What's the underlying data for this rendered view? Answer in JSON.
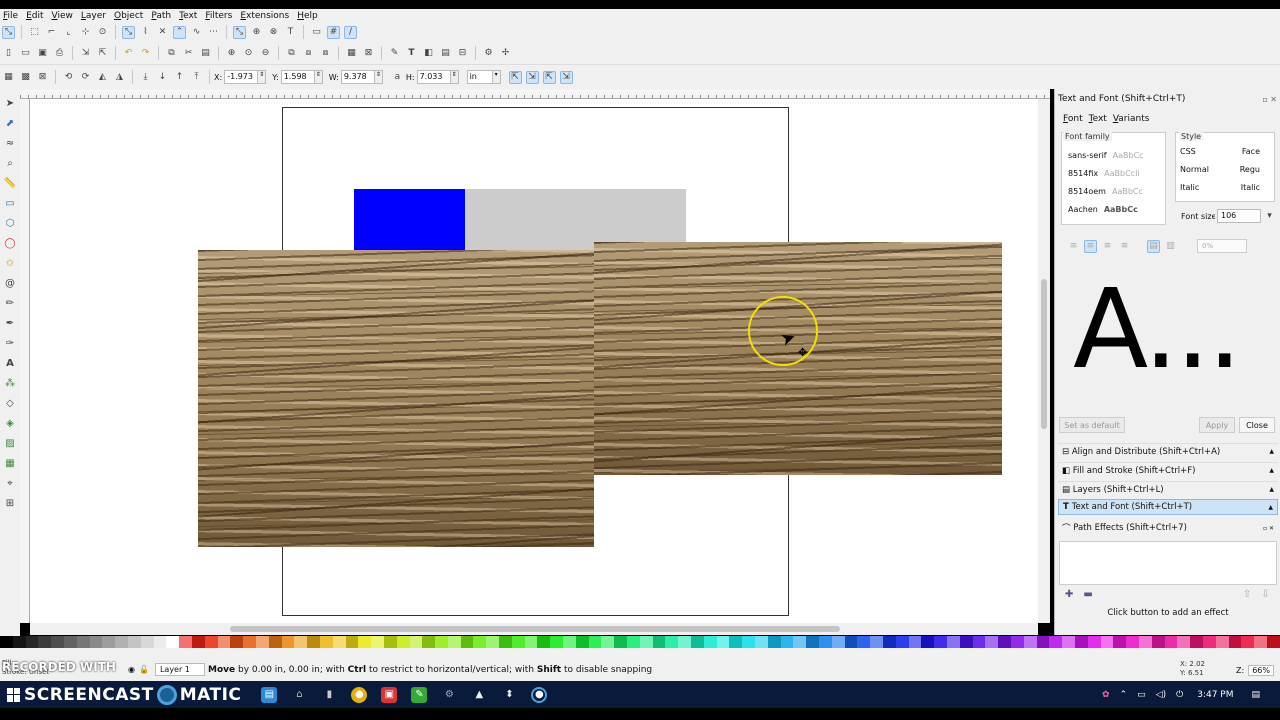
{
  "menu": [
    "File",
    "Edit",
    "View",
    "Layer",
    "Object",
    "Path",
    "Text",
    "Filters",
    "Extensions",
    "Help"
  ],
  "toolbar": {
    "x_label": "X:",
    "x_value": "-1.973",
    "y_label": "Y:",
    "y_value": "1.598",
    "w_label": "W:",
    "w_value": "9.378",
    "h_label": "H:",
    "h_value": "7.033",
    "unit": "in"
  },
  "dock": {
    "title": "Text and Font (Shift+Ctrl+T)",
    "tabs": [
      "Font",
      "Text",
      "Variants"
    ],
    "font_family_label": "Font family",
    "style_label": "Style",
    "font_list": [
      {
        "name": "sans-serif",
        "preview": "AaBbCc"
      },
      {
        "name": "8514fix",
        "preview": "AaBbCcIi"
      },
      {
        "name": "8514oem",
        "preview": "AaBbCc"
      },
      {
        "name": "Aachen",
        "preview": "AaBbCc"
      }
    ],
    "style_list": [
      {
        "css": "CSS",
        "face": "Face"
      },
      {
        "css": "Normal",
        "face": "Regu"
      },
      {
        "css": "Italic",
        "face": "Italic"
      }
    ],
    "font_size_label": "Font size",
    "font_size_value": "106",
    "line_spacing": "0%",
    "preview_text": "A...",
    "set_default": "Set as default",
    "apply": "Apply",
    "close": "Close",
    "dialogs": [
      {
        "label": "Align and Distribute (Shift+Ctrl+A)"
      },
      {
        "label": "Fill and Stroke (Shift+Ctrl+F)"
      },
      {
        "label": "Layers (Shift+Ctrl+L)"
      },
      {
        "label": "Text and Font (Shift+Ctrl+T)"
      }
    ],
    "path_effects_title": "Path Effects (Shift+Ctrl+7)",
    "path_effects_hint": "Click button to add an effect"
  },
  "status": {
    "fill_label": "Fill:",
    "stroke_label": "Stroke:",
    "stroke_value": "Unset",
    "layer": "Layer 1",
    "message_bold1": "Move",
    "message1": " by 0.00 in, 0.00 in; with ",
    "message_bold2": "Ctrl",
    "message2": " to restrict to horizontal/vertical; with ",
    "message_bold3": "Shift",
    "message3": " to disable snapping",
    "cursor_x_label": "X:",
    "cursor_x": "2.02",
    "cursor_y_label": "Y:",
    "cursor_y": "6.51",
    "zoom_label": "Z:",
    "zoom": "66%"
  },
  "watermark": "RECORDED WITH",
  "taskbar": {
    "brand_left": "SCREENCAST",
    "brand_right": "MATIC",
    "time": "3:47 PM"
  },
  "colors": {
    "blue_rect": "#0000ff",
    "gray_rect": "#cccccc",
    "red_rect": "#ff0000",
    "cursor_highlight": "#f2e000"
  }
}
